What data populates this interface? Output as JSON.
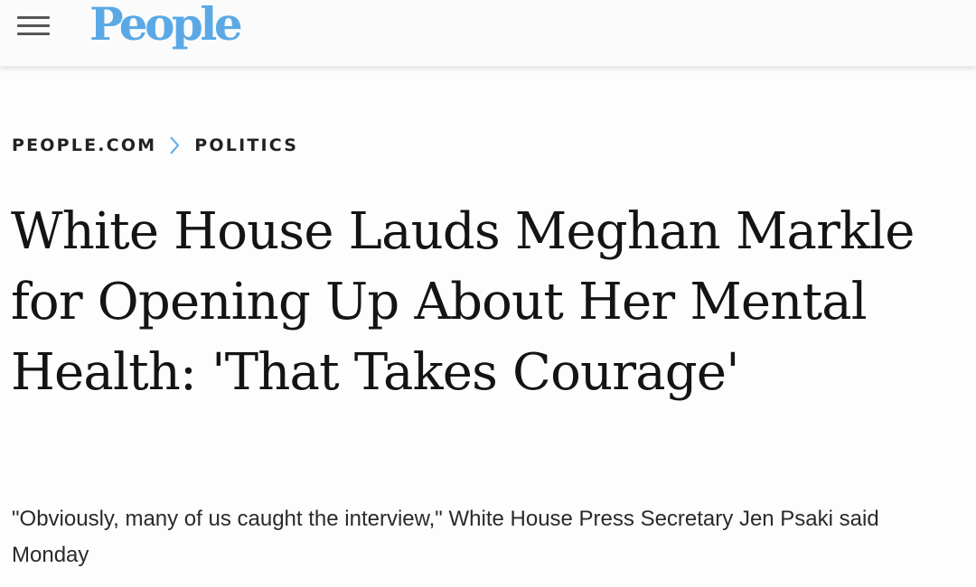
{
  "site": {
    "logo_text": "People",
    "accent_color": "#5aa9e6",
    "menu_icon": "hamburger-menu-icon"
  },
  "breadcrumb": {
    "items": [
      {
        "label": "PEOPLE.COM"
      },
      {
        "label": "POLITICS"
      }
    ],
    "separator_icon": "chevron-right-icon"
  },
  "article": {
    "headline": "White House Lauds Meghan Markle for Opening Up About Her Mental Health: 'That Takes Courage'",
    "dek": "\"Obviously, many of us caught the interview,\" White House Press Secretary Jen Psaki said Monday"
  }
}
